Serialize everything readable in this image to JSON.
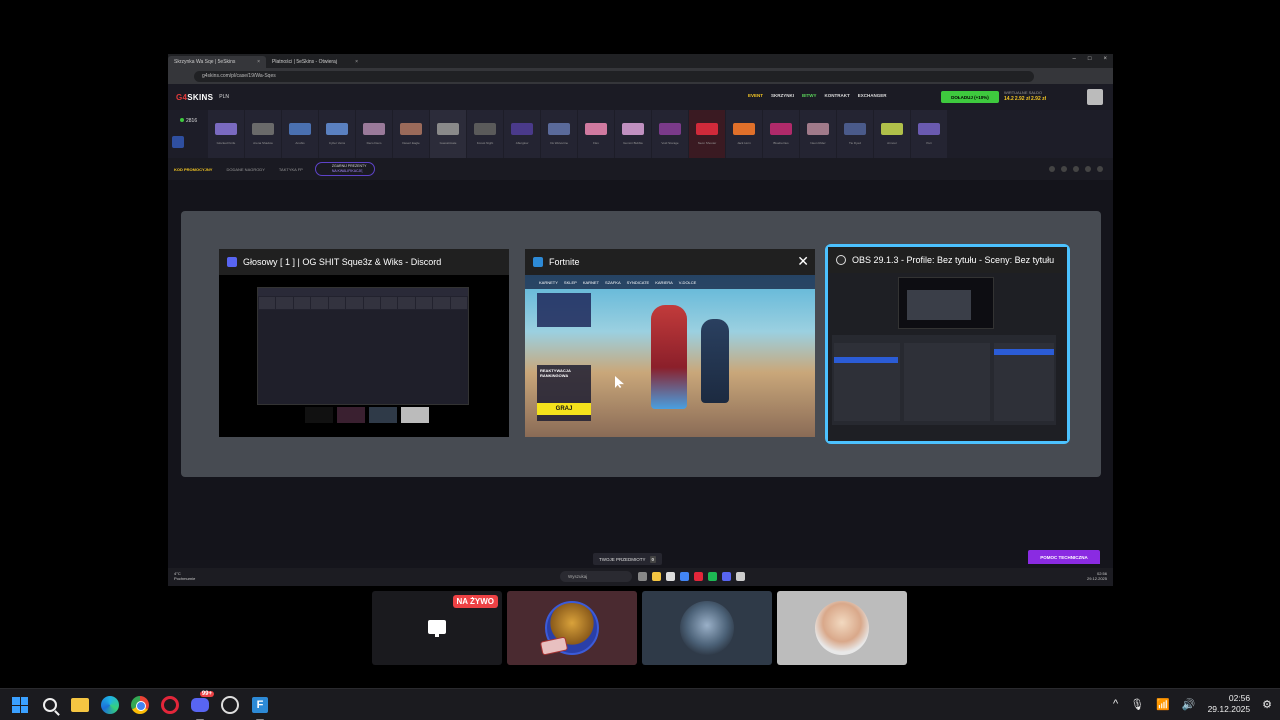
{
  "browser": {
    "tabs": [
      {
        "label": "Skrzynka Wa Sqe | 5eSkins",
        "active": true
      },
      {
        "label": "Płatności | 5eSkins - Otwieraj",
        "active": false
      }
    ],
    "address": "g4skins.com/pl/case/19/Wa-Sqes"
  },
  "site": {
    "logo_main": "G4",
    "logo_rest": "SKINS",
    "lang": "PLN",
    "nav": [
      "EVENT",
      "SKRZYNKI",
      "BITWY",
      "KONTRAKT",
      "EXCHANGER"
    ],
    "deposit_label": "DOŁADUJ (+10%)",
    "balance_label": "WIRTUALNE SALDO",
    "balance_values": [
      "14.2",
      "2.92 zł",
      "2.92 zł"
    ],
    "online_count": "2816",
    "skins": [
      "Glocked Knife",
      "Arena Shadow",
      "Anubis",
      "Cyber Veins",
      "Deco Deco",
      "Desert Eagle",
      "Guesstimate",
      "Forest Night",
      "Afterglow",
      "Iris Wolverine",
      "Flex",
      "Gummi Bubble",
      "Void Storage",
      "Neon Shooter",
      "Jack Horn",
      "Blueberries",
      "Neon Rider",
      "Tie Dyed",
      "Armour",
      "Peri"
    ],
    "subbar": [
      "KOD PROMOCYJNY",
      "DODANE NAGRODY",
      "TAKTYKA FP"
    ],
    "promo_line1": "ZGARNIJ PREZENTY",
    "promo_line2": "NA KWALIFIKACJĘ"
  },
  "alt_tab": {
    "windows": [
      {
        "title": "Głosowy [ 1 ] | OG SHIT Sque3z & Wiks - Discord",
        "icon": "discord-icon",
        "selected": false
      },
      {
        "title": "Fortnite",
        "icon": "fortnite-icon",
        "selected": false,
        "show_close": true
      },
      {
        "title": "OBS 29.1.3 - Profile: Bez tytułu - Sceny: Bez tytułu",
        "icon": "obs-icon",
        "selected": true
      }
    ],
    "close_glyph": "✕"
  },
  "fortnite_preview": {
    "menu": [
      "KARNETY",
      "SKLEP",
      "KARNET",
      "SZAFKA",
      "SYNDICATE",
      "KARIERA",
      "V-DOLCE"
    ],
    "panel_title": "REAKTYWACJA RANKINGOWA",
    "play_label": "GRAJ"
  },
  "inner_page": {
    "your_items_label": "TWOJE PRZEDMIOTY",
    "your_items_count": "0",
    "help_label": "POMOC TECHNICZNA"
  },
  "inner_taskbar": {
    "weather_temp": "4°C",
    "weather_desc": "Pochmurnie",
    "search_placeholder": "Wyszukaj",
    "time": "02:56",
    "date": "29.12.2025"
  },
  "participants": {
    "live_badge": "NA ŻYWO"
  },
  "taskbar": {
    "discord_badge": "99+",
    "time": "02:56",
    "date": "29.12.2025",
    "tray_chevron": "^"
  }
}
